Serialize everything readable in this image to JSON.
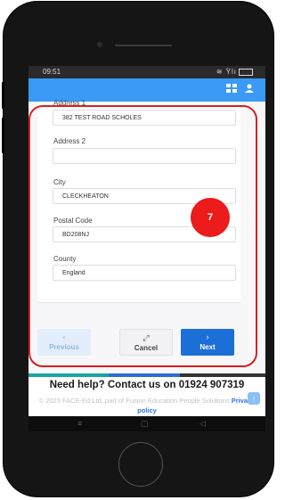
{
  "status": {
    "time": "09:51",
    "icons": "≋ Ϋlı"
  },
  "form": {
    "address1": {
      "label": "Address 1",
      "value": "382 TEST ROAD SCHOLES"
    },
    "address2": {
      "label": "Address 2",
      "value": ""
    },
    "city": {
      "label": "City",
      "value": "CLECKHEATON"
    },
    "postal_code": {
      "label": "Postal Code",
      "value": "BD208NJ"
    },
    "county": {
      "label": "County",
      "value": "England"
    }
  },
  "step_badge": "7",
  "buttons": {
    "previous": {
      "label": "Previous",
      "arrow": "‹"
    },
    "cancel": {
      "label": "Cancel",
      "arrow": "⤢"
    },
    "next": {
      "label": "Next",
      "arrow": "›"
    }
  },
  "help_text": "Need help? Contact us on 01924 907319",
  "footer": {
    "copyright": "© 2023 FACE-Ed Ltd, part of Fusion Education People Solutions",
    "privacy": "Privacy policy"
  },
  "colors": {
    "accent": "#3a9af6",
    "highlight": "#d91f1f",
    "next_button": "#1c6fd6",
    "progress": [
      "#1aa3a3",
      "#2a6fd4",
      "#333333"
    ]
  },
  "icons": {
    "header_grid": "grid-icon",
    "header_profile": "profile-icon",
    "scroll_top": "arrow-up-icon"
  }
}
